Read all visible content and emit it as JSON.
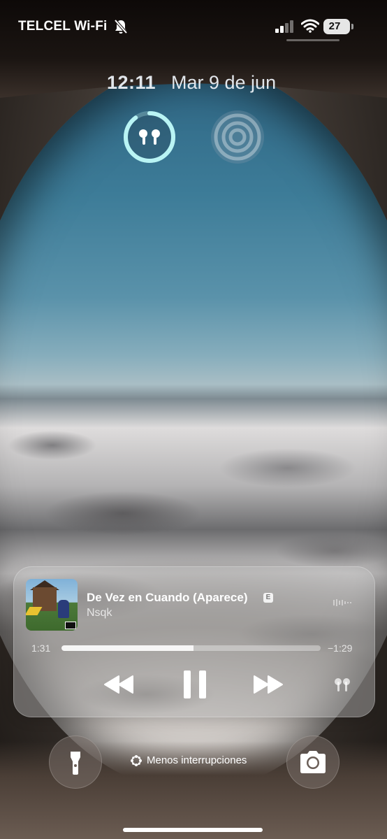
{
  "status_bar": {
    "carrier": "TELCEL Wi-Fi",
    "silent_icon": "bell-slash-icon",
    "signal_icon": "cellular-signal-icon",
    "wifi_icon": "wifi-icon",
    "battery_level": "27"
  },
  "lock_screen": {
    "time": "12:11",
    "date": "Mar 9 de jun"
  },
  "widgets": [
    {
      "name": "airpods-battery",
      "icon": "airpods-icon",
      "ring_fraction": 0.9
    },
    {
      "name": "focus",
      "icon": "concentric-circles-icon"
    }
  ],
  "now_playing": {
    "title": "De Vez en Cuando (Aparece)",
    "explicit_badge": "E",
    "artist": "Nsqk",
    "elapsed": "1:31",
    "remaining": "−1:29",
    "progress_fraction": 0.51,
    "controls": [
      "rewind-icon",
      "pause-icon",
      "fast-forward-icon",
      "airpods-output-icon"
    ]
  },
  "bottom": {
    "flashlight_icon": "flashlight-icon",
    "focus_label": "Menos interrupciones",
    "focus_icon": "focus-flower-icon",
    "camera_icon": "camera-icon"
  },
  "colors": {
    "widget_ring": "#b9f4f4",
    "player_background": "rgba(185,185,185,0.45)"
  }
}
